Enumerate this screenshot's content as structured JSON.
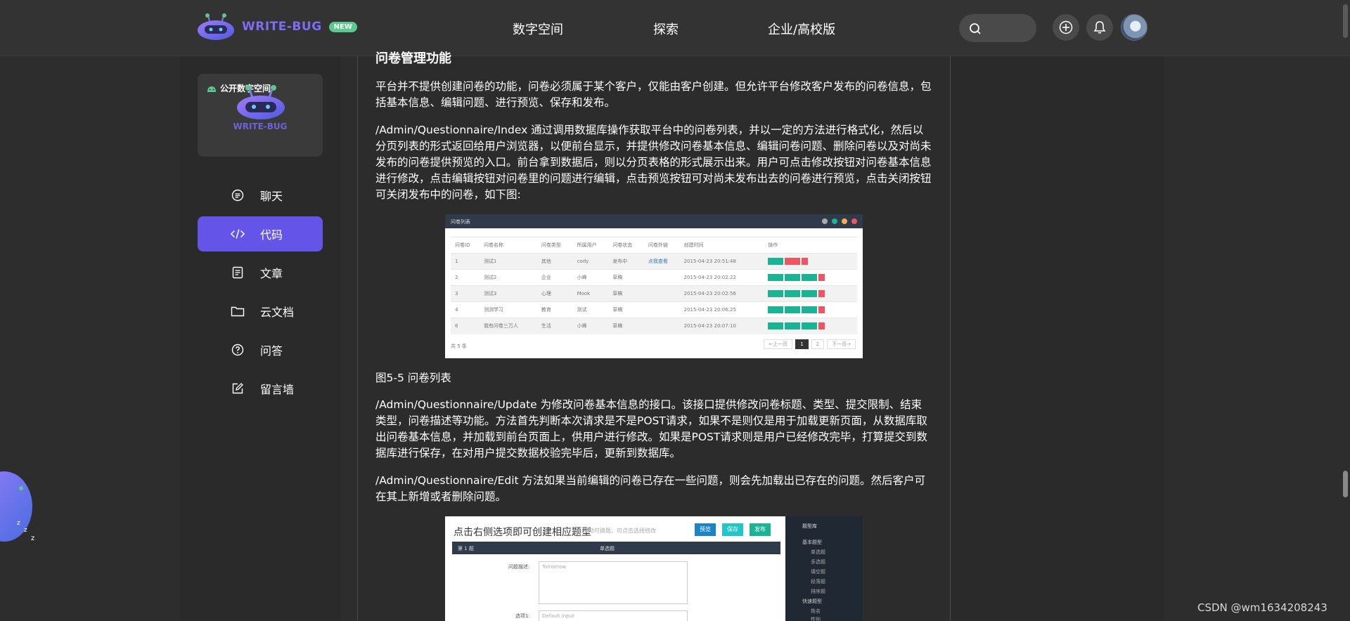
{
  "header": {
    "logo_text": "WRITE-BUG",
    "new_badge": "NEW",
    "nav": [
      "数字空间",
      "探索",
      "企业/高校版"
    ]
  },
  "sidebar": {
    "space_label": "公开数字空间",
    "space_logo_text": "WRITE-BUG",
    "items": [
      {
        "label": "聊天",
        "icon": "chat-icon"
      },
      {
        "label": "代码",
        "icon": "code-icon",
        "active": true
      },
      {
        "label": "文章",
        "icon": "article-icon"
      },
      {
        "label": "云文档",
        "icon": "folder-icon"
      },
      {
        "label": "问答",
        "icon": "question-icon"
      },
      {
        "label": "留言墙",
        "icon": "edit-icon"
      }
    ]
  },
  "article": {
    "heading": "问卷管理功能",
    "p1": "平台并不提供创建问卷的功能，问卷必须属于某个客户，仅能由客户创建。但允许平台修改客户发布的问卷信息，包括基本信息、编辑问题、进行预览、保存和发布。",
    "p2": "/Admin/Questionnaire/Index 通过调用数据库操作获取平台中的问卷列表，并以一定的方法进行格式化，然后以分页列表的形式返回给用户浏览器，以便前台显示，并提供修改问卷基本信息、编辑问卷问题、删除问卷以及对尚未发布的问卷提供预览的入口。前台拿到数据后，则以分页表格的形式展示出来。用户可点击修改按钮对问卷基本信息进行修改，点击编辑按钮对问卷里的问题进行编辑，点击预览按钮可对尚未发布出去的问卷进行预览，点击关闭按钮可关闭发布中的问卷，如下图:",
    "caption": "图5-5 问卷列表",
    "p3": "/Admin/Questionnaire/Update 为修改问卷基本信息的接口。该接口提供修改问卷标题、类型、提交限制、结束类型，问卷描述等功能。方法首先判断本次请求是不是POST请求，如果不是则仅是用于加载更新页面，从数据库取出问卷基本信息，并加载到前台页面上，供用户进行修改。如果是POST请求则是用户已经修改完毕，打算提交到数据库进行保存，在对用户提交数据校验完毕后，更新到数据库。",
    "p4": "/Admin/Questionnaire/Edit 方法如果当前编辑的问卷已存在一些问题，则会先加载出已存在的问题。然后客户可在其上新增或者删除问题。"
  },
  "shot1": {
    "title": "问卷列表",
    "headers": [
      "问卷ID",
      "问卷名称",
      "问卷类型",
      "所属用户",
      "问卷状态",
      "问卷外链",
      "创建时间",
      "操作"
    ],
    "rows": [
      [
        "1",
        "测试1",
        "其他",
        "cody",
        "发布中",
        "点我查看",
        "2015-04-23 20:51:48"
      ],
      [
        "2",
        "测试2",
        "企业",
        "小峰",
        "草稿",
        "",
        "2015-04-23 20:02:22"
      ],
      [
        "3",
        "测试3",
        "心理",
        "Mook",
        "草稿",
        "",
        "2015-04-23 20:02:56"
      ],
      [
        "4",
        "测测学习",
        "教育",
        "测试",
        "草稿",
        "",
        "2015-04-23 20:06:25"
      ],
      [
        "6",
        "我有问卷三万人",
        "生活",
        "小峰",
        "草稿",
        "",
        "2015-04-23 20:07:10"
      ]
    ],
    "footer": "共 5 条",
    "pager": [
      "←上一页",
      "1",
      "2",
      "下一页→"
    ]
  },
  "shot2": {
    "title": "点击右侧选项即可创建相应题型",
    "subtitle": "拖动可换题，可点击选择修改",
    "buttons": [
      "预览",
      "保存",
      "发布"
    ],
    "panel_left": "第 1 题",
    "panel_center": "单选题",
    "label1": "问题描述:",
    "placeholder1": "Tomorrow",
    "label2": "选项1:",
    "placeholder2": "Default input",
    "side_title": "题型库",
    "side_items": [
      "基本题型",
      "单选题",
      "多选题",
      "填空题",
      "段落题",
      "排序题",
      "快速题型",
      "姓名",
      "性别"
    ]
  },
  "watermark": "CSDN @wm1634208243",
  "colors": {
    "accent": "#6455e8",
    "background": "#2d2d2d",
    "new_badge": "#5bc98f"
  }
}
